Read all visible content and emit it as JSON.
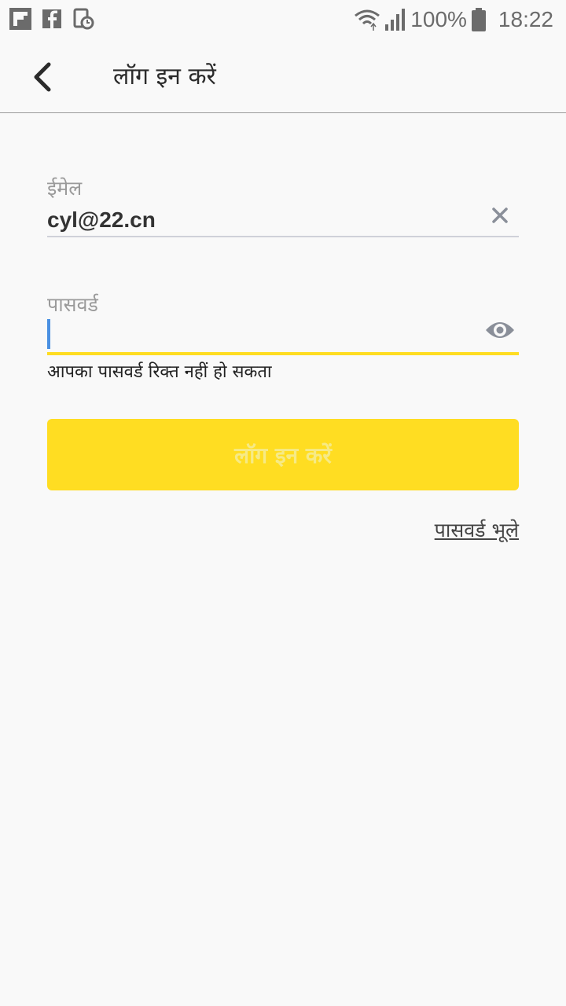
{
  "status_bar": {
    "battery_percent": "100%",
    "time": "18:22",
    "left_icons": [
      "flipboard-icon",
      "facebook-icon",
      "screen-timeout-icon"
    ],
    "right_icons": [
      "wifi-icon",
      "signal-icon",
      "battery-icon"
    ]
  },
  "toolbar": {
    "back_icon": "chevron-left-icon",
    "title": "लॉग इन करें"
  },
  "form": {
    "email_label": "ईमेल",
    "email_value": "cyl@22.cn",
    "password_label": "पासवर्ड",
    "password_value": "",
    "password_error": "आपका पासवर्ड रिक्त नहीं हो सकता"
  },
  "login_button_label": "लॉग इन करें",
  "forgot_password_label": "पासवर्ड भूले",
  "colors": {
    "accent": "#ffdd22",
    "cursor": "#4a90e2",
    "background": "#f9f9f9"
  }
}
